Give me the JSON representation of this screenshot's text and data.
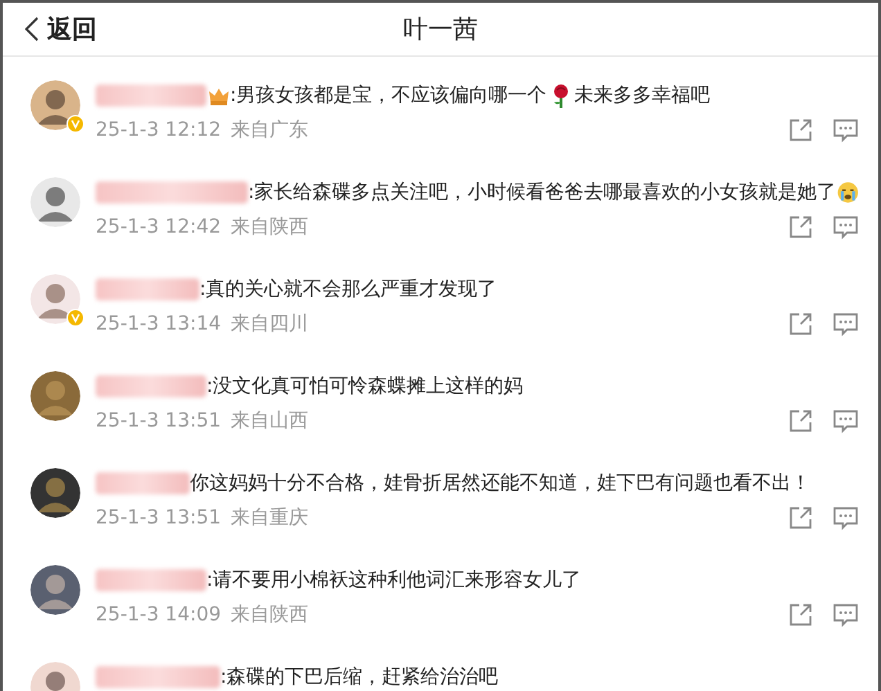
{
  "header": {
    "back_label": "返回",
    "title": "叶一茜"
  },
  "comments": [
    {
      "verified": true,
      "name_sticker": true,
      "parts": [
        {
          "kind": "text",
          "text": ":男孩女孩都是宝，不应该偏向哪一个"
        },
        {
          "kind": "rose"
        },
        {
          "kind": "text",
          "text": "未来多多幸福吧"
        }
      ],
      "time": "25-1-3 12:12",
      "location": "来自广东"
    },
    {
      "verified": false,
      "name_sticker": false,
      "parts": [
        {
          "kind": "text",
          "text": ":家长给森碟多点关注吧，小时候看爸爸去哪最喜欢的小女孩就是她了"
        },
        {
          "kind": "crying"
        }
      ],
      "time": "25-1-3 12:42",
      "location": "来自陕西"
    },
    {
      "verified": true,
      "name_sticker": false,
      "parts": [
        {
          "kind": "text",
          "text": ":真的关心就不会那么严重才发现了"
        }
      ],
      "time": "25-1-3 13:14",
      "location": "来自四川"
    },
    {
      "verified": false,
      "name_sticker": false,
      "parts": [
        {
          "kind": "text",
          "text": ":没文化真可怕可怜森蝶摊上这样的妈"
        }
      ],
      "time": "25-1-3 13:51",
      "location": "来自山西"
    },
    {
      "verified": false,
      "name_sticker": false,
      "parts": [
        {
          "kind": "text",
          "text": "你这妈妈十分不合格，娃骨折居然还能不知道，娃下巴有问题也看不出！"
        }
      ],
      "time": "25-1-3 13:51",
      "location": "来自重庆"
    },
    {
      "verified": false,
      "name_sticker": false,
      "parts": [
        {
          "kind": "text",
          "text": ":请不要用小棉袄这种利他词汇来形容女儿了"
        }
      ],
      "time": "25-1-3 14:09",
      "location": "来自陕西"
    },
    {
      "verified": false,
      "name_sticker": false,
      "parts": [
        {
          "kind": "text",
          "text": ":森碟的下巴后缩，赶紧给治治吧"
        }
      ]
    }
  ]
}
